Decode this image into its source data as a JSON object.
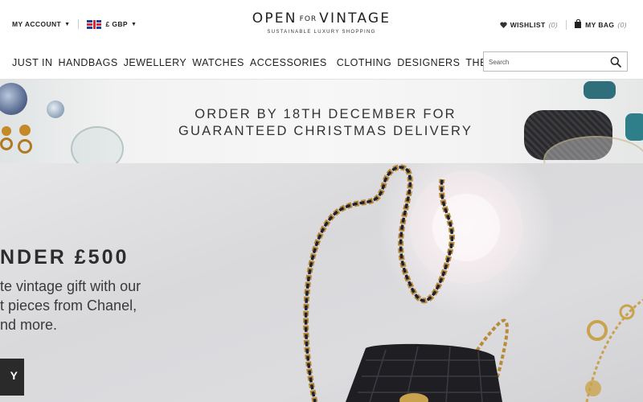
{
  "header": {
    "account_label": "MY ACCOUNT",
    "currency_label": "£ GBP",
    "logo_main_left": "OPEN",
    "logo_main_for": "FOR",
    "logo_main_right": "VINTAGE",
    "logo_tagline": "SUSTAINABLE LUXURY SHOPPING",
    "wishlist_label": "WISHLIST",
    "wishlist_count": "(0)",
    "bag_label": "MY BAG",
    "bag_count": "(0)"
  },
  "nav": {
    "items": [
      "JUST IN",
      "HANDBAGS",
      "JEWELLERY",
      "WATCHES",
      "ACCESSORIES",
      "CLOTHING",
      "DESIGNERS",
      "THE JOURNAL"
    ]
  },
  "search": {
    "placeholder": "Search",
    "icon": "search-icon"
  },
  "promo": {
    "line1": "ORDER BY 18TH DECEMBER FOR",
    "line2": "GUARANTEED CHRISTMAS DELIVERY"
  },
  "hero": {
    "title": "NDER £500",
    "desc_line1": "te vintage gift with our",
    "desc_line2": "t pieces from Chanel,",
    "desc_line3": "nd more.",
    "button_label": "Y"
  },
  "colors": {
    "text": "#222222",
    "button": "#2a2a2a",
    "accent_red": "#d52b3c"
  }
}
